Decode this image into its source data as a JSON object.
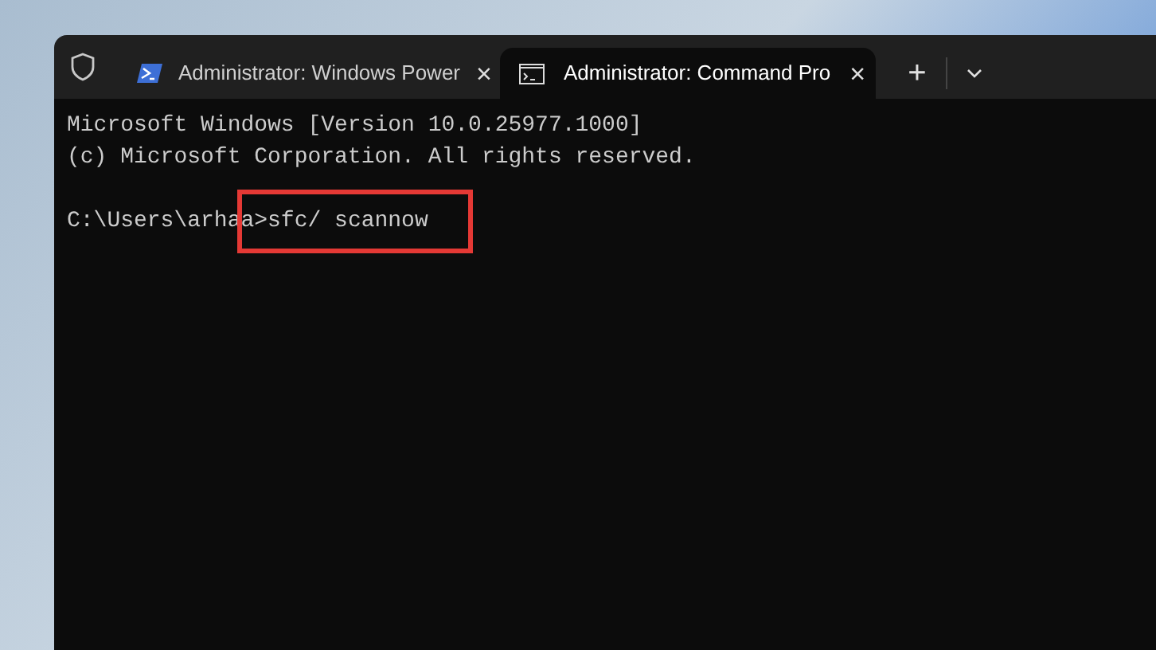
{
  "tabs": [
    {
      "kind": "powershell",
      "title": "Administrator: Windows Power",
      "close": "×",
      "selected": false
    },
    {
      "kind": "cmd",
      "title": "Administrator: Command Pro",
      "close": "×",
      "selected": true
    }
  ],
  "new_tab": "+",
  "terminal": {
    "lines": [
      {
        "text": "Microsoft Windows [Version 10.0.25977.1000]"
      },
      {
        "text": "(c) Microsoft Corporation. All rights reserved."
      }
    ],
    "prompt": {
      "path": "C:\\Users\\arhaa>",
      "command": "sfc/ scannow",
      "highlighted": true
    }
  }
}
